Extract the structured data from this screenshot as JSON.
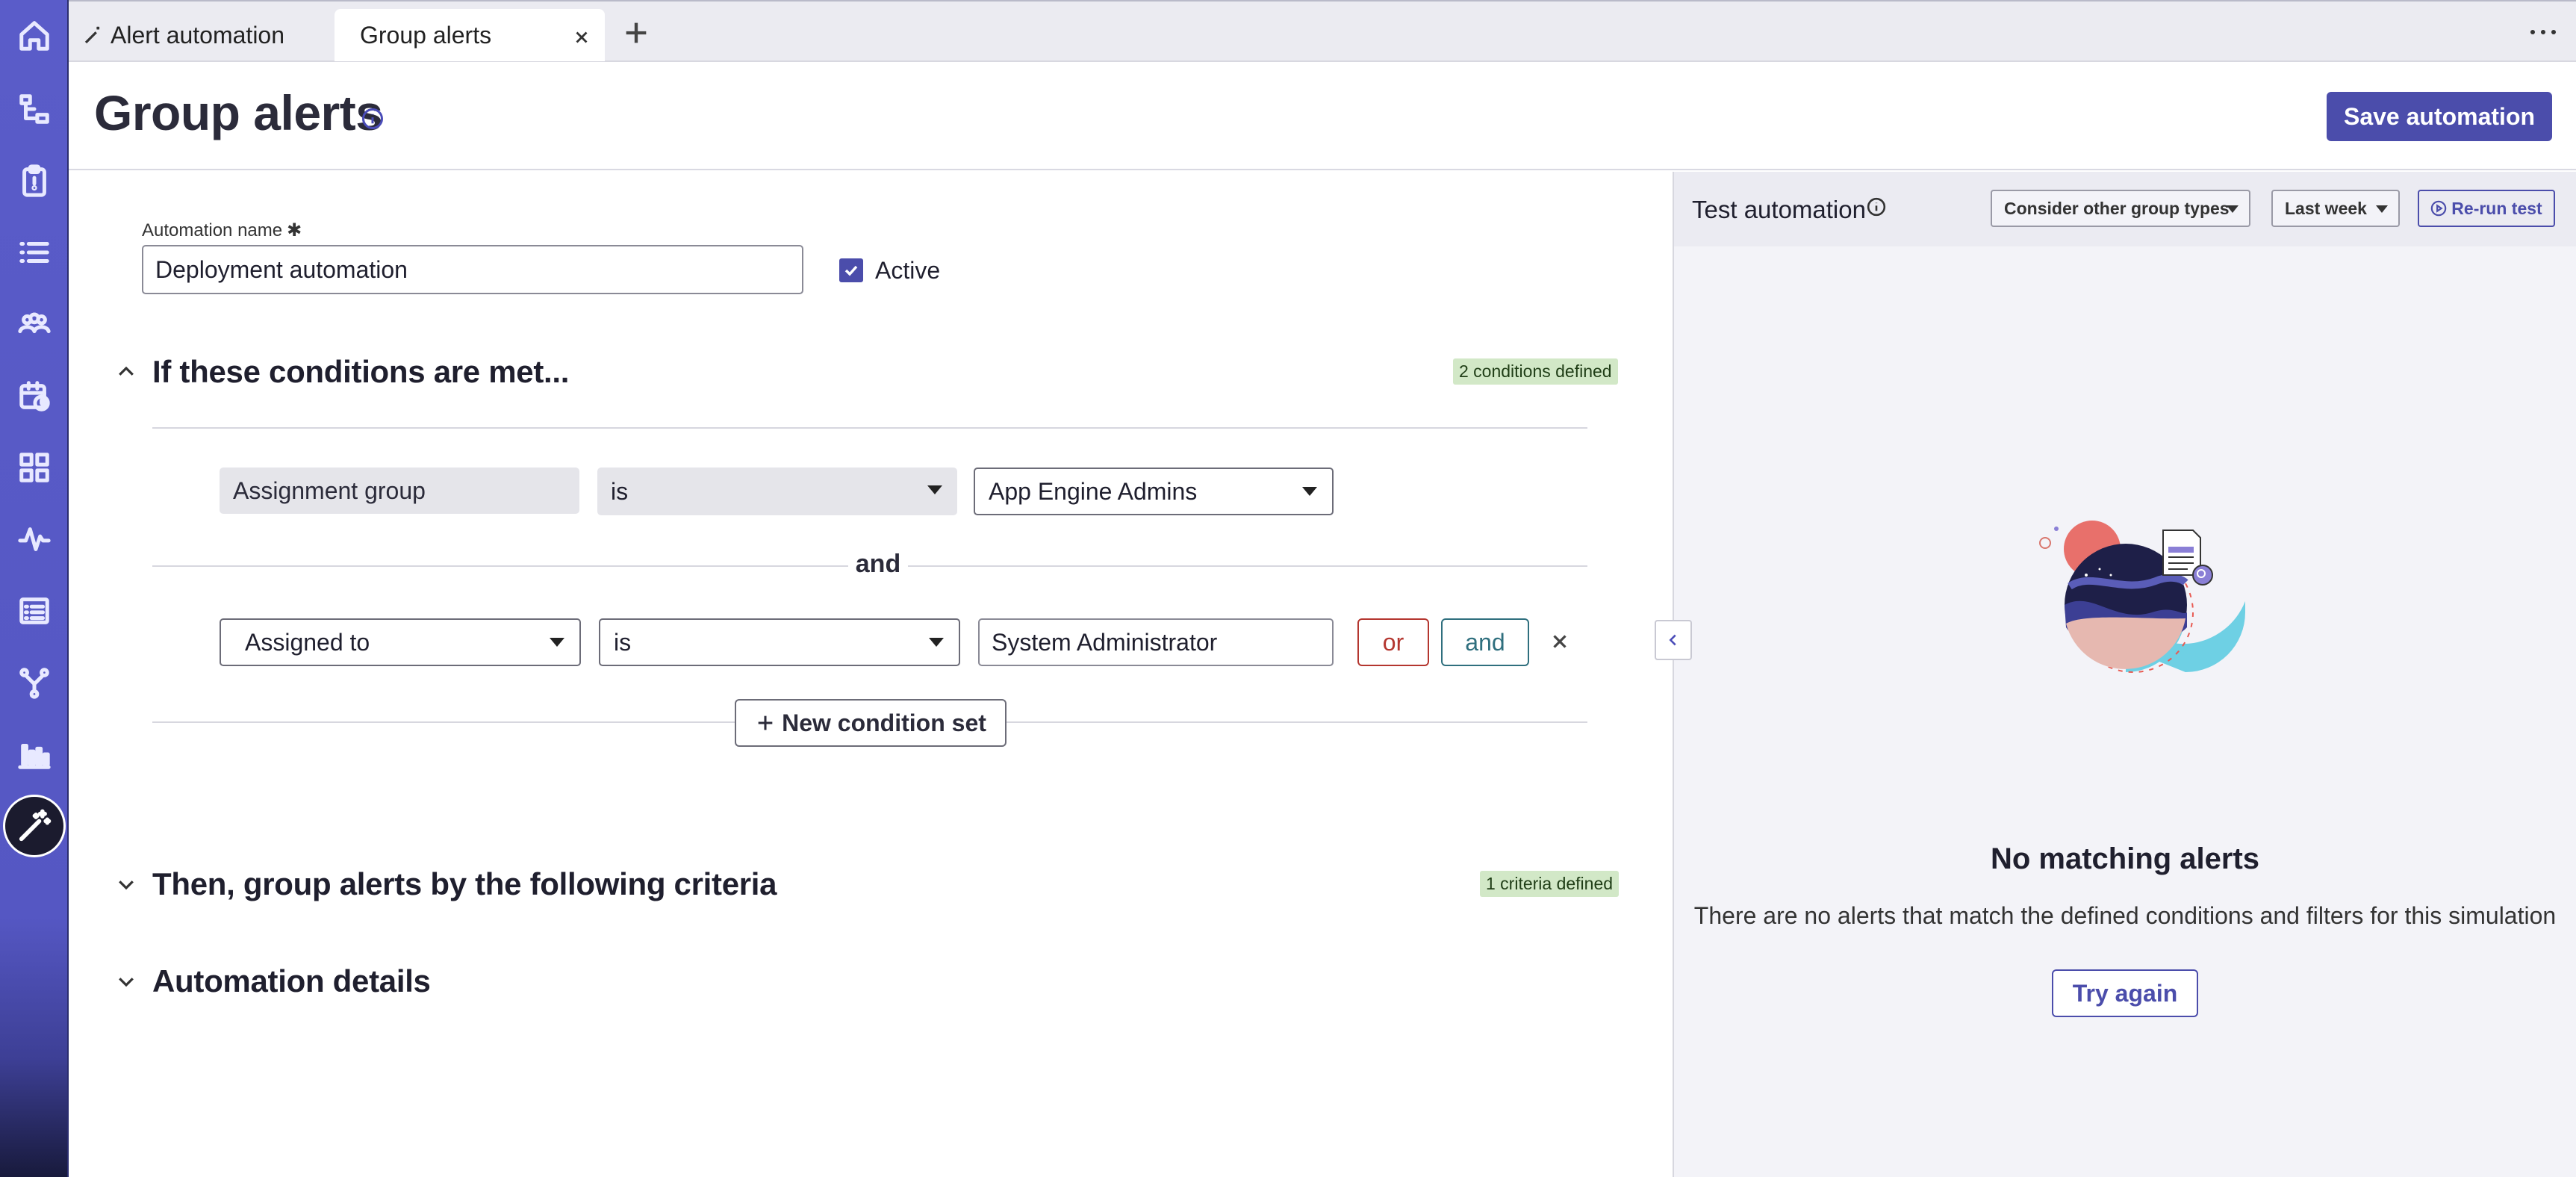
{
  "tabs": {
    "first_label": "Alert automation",
    "current_label": "Group alerts"
  },
  "header": {
    "title": "Group alerts",
    "save_label": "Save automation"
  },
  "form": {
    "name_label": "Automation name",
    "name_required_mark": "✱",
    "name_value": "Deployment automation",
    "active_label": "Active",
    "active_checked": true
  },
  "conditions": {
    "title": "If these conditions are met...",
    "badge": "2 conditions defined",
    "row1": {
      "field": "Assignment group",
      "operator": "is",
      "value": "App Engine Admins"
    },
    "connector": "and",
    "row2": {
      "field": "Assigned to",
      "operator": "is",
      "value": "System Administrator"
    },
    "or_button": "or",
    "and_button": "and",
    "new_condition_set": "New condition set"
  },
  "grouping": {
    "title": "Then, group alerts by the following criteria",
    "badge": "1 criteria defined"
  },
  "details": {
    "title": "Automation details"
  },
  "test_panel": {
    "title": "Test automation",
    "group_types_dropdown": "Consider other group types",
    "period_dropdown": "Last week",
    "rerun_label": "Re-run test",
    "empty_title": "No matching alerts",
    "empty_desc": "There are no alerts that match the defined conditions and filters for this simulation",
    "try_again": "Try again"
  },
  "colors": {
    "rail": "#5557c3",
    "accent": "#4b4dab",
    "or_color": "#b4362f",
    "and_color": "#2f6f7e",
    "badge_bg": "#d2e8c7"
  },
  "icons": [
    "home-icon",
    "hierarchy-icon",
    "clipboard-icon",
    "list-icon",
    "group-icon",
    "calendar-clock-icon",
    "grid-icon",
    "pulse-icon",
    "form-list-icon",
    "branch-icon",
    "bar-chart-icon",
    "magic-wand-icon"
  ]
}
